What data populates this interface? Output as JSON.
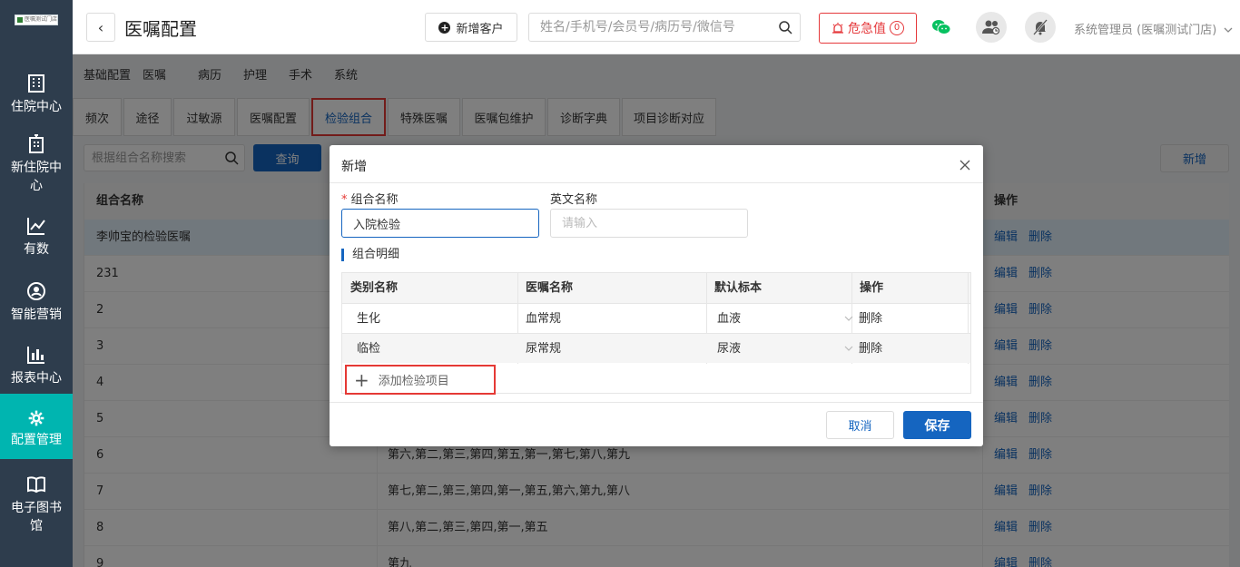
{
  "sidebar": {
    "logo_text": "医嘱测试门店",
    "items": [
      {
        "label": "住院中心",
        "icon": "hospital-icon"
      },
      {
        "label": "新住院中心",
        "icon": "building-icon"
      },
      {
        "label": "有数",
        "icon": "trend-icon"
      },
      {
        "label": "智能营销",
        "icon": "marketing-icon"
      },
      {
        "label": "报表中心",
        "icon": "bar-chart-icon"
      },
      {
        "label": "配置管理",
        "icon": "gear-icon",
        "active": true
      },
      {
        "label": "电子图书馆",
        "icon": "book-icon"
      }
    ]
  },
  "header": {
    "back": "‹",
    "title": "医嘱配置",
    "add_customer": "新增客户",
    "search_placeholder": "姓名/手机号/会员号/病历号/微信号",
    "alert_label": "危急值",
    "alert_count": "0",
    "user": "系统管理员 (医嘱测试门店)"
  },
  "top_tabs": [
    "基础配置",
    "医嘱",
    "病历",
    "护理",
    "手术",
    "系统"
  ],
  "sub_tabs": [
    "频次",
    "途径",
    "过敏源",
    "医嘱配置",
    "检验组合",
    "特殊医嘱",
    "医嘱包维护",
    "诊断字典",
    "项目诊断对应"
  ],
  "toolbar": {
    "search_placeholder": "根据组合名称搜索",
    "query": "查询",
    "new": "新增"
  },
  "table": {
    "columns": [
      "组合名称",
      "操作"
    ],
    "rows": [
      {
        "name": "李帅宝的检验医嘱",
        "detail": ""
      },
      {
        "name": "231",
        "detail": ""
      },
      {
        "name": "2",
        "detail": ""
      },
      {
        "name": "3",
        "detail": ""
      },
      {
        "name": "4",
        "detail": ""
      },
      {
        "name": "5",
        "detail": ""
      },
      {
        "name": "6",
        "detail": "第六,第二,第三,第四,第五,第一,第七,第八,第九"
      },
      {
        "name": "7",
        "detail": "第七,第二,第三,第四,第一,第五,第六,第九,第八"
      },
      {
        "name": "8",
        "detail": "第八,第二,第三,第四,第一,第五"
      },
      {
        "name": "9",
        "detail": "第九"
      }
    ],
    "edit": "编辑",
    "delete": "删除"
  },
  "modal": {
    "title": "新增",
    "name_label": "组合名称",
    "name_value": "入院检验",
    "en_label": "英文名称",
    "en_placeholder": "请输入",
    "section": "组合明细",
    "columns": [
      "类别名称",
      "医嘱名称",
      "默认标本",
      "操作"
    ],
    "rows": [
      {
        "category": "生化",
        "order": "血常规",
        "specimen": "血液",
        "op": "删除"
      },
      {
        "category": "临检",
        "order": "尿常规",
        "specimen": "尿液",
        "op": "删除"
      }
    ],
    "add_item": "添加检验项目",
    "cancel": "取消",
    "save": "保存"
  }
}
